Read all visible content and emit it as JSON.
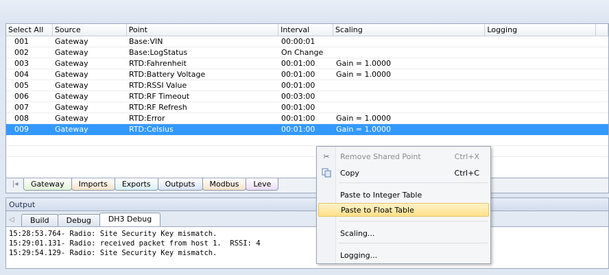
{
  "grid": {
    "columns": [
      "Select All",
      "Source",
      "Point",
      "Interval",
      "Scaling",
      "Logging"
    ],
    "rows": [
      {
        "sel": "001",
        "source": "Gateway",
        "point": "Base:VIN",
        "interval": "00:00:01",
        "scaling": "",
        "logging": ""
      },
      {
        "sel": "002",
        "source": "Gateway",
        "point": "Base:LogStatus",
        "interval": "On Change",
        "scaling": "",
        "logging": ""
      },
      {
        "sel": "003",
        "source": "Gateway",
        "point": "RTD:Fahrenheit",
        "interval": "00:01:00",
        "scaling": "Gain = 1.0000",
        "logging": ""
      },
      {
        "sel": "004",
        "source": "Gateway",
        "point": "RTD:Battery Voltage",
        "interval": "00:01:00",
        "scaling": "Gain = 1.0000",
        "logging": ""
      },
      {
        "sel": "005",
        "source": "Gateway",
        "point": "RTD:RSSI Value",
        "interval": "00:01:00",
        "scaling": "",
        "logging": ""
      },
      {
        "sel": "006",
        "source": "Gateway",
        "point": "RTD:RF Timeout",
        "interval": "00:03:00",
        "scaling": "",
        "logging": ""
      },
      {
        "sel": "007",
        "source": "Gateway",
        "point": "RTD:RF Refresh",
        "interval": "00:01:00",
        "scaling": "",
        "logging": ""
      },
      {
        "sel": "008",
        "source": "Gateway",
        "point": "RTD:Error",
        "interval": "00:01:00",
        "scaling": "Gain = 1.0000",
        "logging": ""
      },
      {
        "sel": "009",
        "source": "Gateway",
        "point": "RTD:Celsius",
        "interval": "00:01:00",
        "scaling": "Gain = 1.0000",
        "logging": ""
      }
    ],
    "selected_row": "009"
  },
  "sheet_tabs": {
    "nav_icon": "first-tab-icon",
    "items": [
      "Gateway",
      "Imports",
      "Exports",
      "Outputs",
      "Modbus",
      "Leve"
    ]
  },
  "output": {
    "title": "Output",
    "nav_icon": "left-arrow-icon",
    "tabs": [
      "Build",
      "Debug",
      "DH3 Debug"
    ],
    "active_tab": "DH3 Debug",
    "lines": [
      "15:28:53.764- Radio: Site Security Key mismatch.",
      "15:29:01.131- Radio: received packet from host 1.  RSSI: 4",
      "15:29:54.129- Radio: Site Security Key mismatch."
    ]
  },
  "context_menu": {
    "items": {
      "remove": {
        "label": "Remove Shared Point",
        "shortcut": "Ctrl+X",
        "icon": "scissors-icon",
        "enabled": false
      },
      "copy": {
        "label": "Copy",
        "shortcut": "Ctrl+C",
        "icon": "copy-icon",
        "enabled": true
      },
      "paste_int": {
        "label": "Paste to Integer Table",
        "shortcut": ""
      },
      "paste_float": {
        "label": "Paste to Float Table",
        "shortcut": "",
        "highlighted": true
      },
      "scaling": {
        "label": "Scaling..."
      },
      "logging": {
        "label": "Logging..."
      }
    }
  },
  "colors": {
    "selection": "#3399ff",
    "menu_highlight": "#ffe08a"
  }
}
